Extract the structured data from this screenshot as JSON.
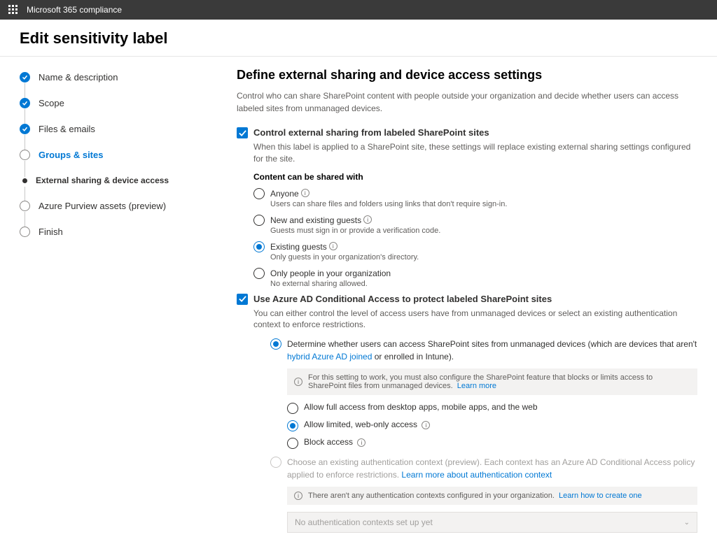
{
  "header": {
    "product": "Microsoft 365 compliance"
  },
  "page_title": "Edit sensitivity label",
  "steps": [
    {
      "label": "Name & description",
      "state": "done"
    },
    {
      "label": "Scope",
      "state": "done"
    },
    {
      "label": "Files & emails",
      "state": "done"
    },
    {
      "label": "Groups & sites",
      "state": "current"
    },
    {
      "label": "External sharing & device access",
      "state": "sub"
    },
    {
      "label": "Azure Purview assets (preview)",
      "state": "pending"
    },
    {
      "label": "Finish",
      "state": "pending"
    }
  ],
  "main": {
    "heading": "Define external sharing and device access settings",
    "description": "Control who can share SharePoint content with people outside your organization and decide whether users can access labeled sites from unmanaged devices.",
    "section1": {
      "checkbox_label": "Control external sharing from labeled SharePoint sites",
      "subtext": "When this label is applied to a SharePoint site, these settings will replace existing external sharing settings configured for the site.",
      "subtitle": "Content can be shared with",
      "options": [
        {
          "label": "Anyone",
          "sub": "Users can share files and folders using links that don't require sign-in.",
          "info": true
        },
        {
          "label": "New and existing guests",
          "sub": "Guests must sign in or provide a verification code.",
          "info": true
        },
        {
          "label": "Existing guests",
          "sub": "Only guests in your organization's directory.",
          "info": true,
          "selected": true
        },
        {
          "label": "Only people in your organization",
          "sub": "No external sharing allowed."
        }
      ]
    },
    "section2": {
      "checkbox_label": "Use Azure AD Conditional Access to protect labeled SharePoint sites",
      "subtext": "You can either control the level of access users have from unmanaged devices or select an existing authentication context to enforce restrictions.",
      "opt1": {
        "text_a": "Determine whether users can access SharePoint sites from unmanaged devices (which are devices that aren't ",
        "link": "hybrid Azure AD joined",
        "text_b": " or enrolled in Intune).",
        "infobox": "For this setting to work, you must also configure the SharePoint feature that blocks or limits access to SharePoint files from unmanaged devices.",
        "infobox_link": "Learn more",
        "sub_options": [
          {
            "label": "Allow full access from desktop apps, mobile apps, and the web"
          },
          {
            "label": "Allow limited, web-only access",
            "selected": true,
            "info": true
          },
          {
            "label": "Block access",
            "info": true
          }
        ]
      },
      "opt2": {
        "text_a": "Choose an existing authentication context (preview). Each context has an Azure AD Conditional Access policy applied to enforce restrictions. ",
        "link": "Learn more about authentication context",
        "infobox": "There aren't any authentication contexts configured in your organization.",
        "infobox_link": "Learn how to create one",
        "dropdown_placeholder": "No authentication contexts set up yet"
      }
    }
  }
}
